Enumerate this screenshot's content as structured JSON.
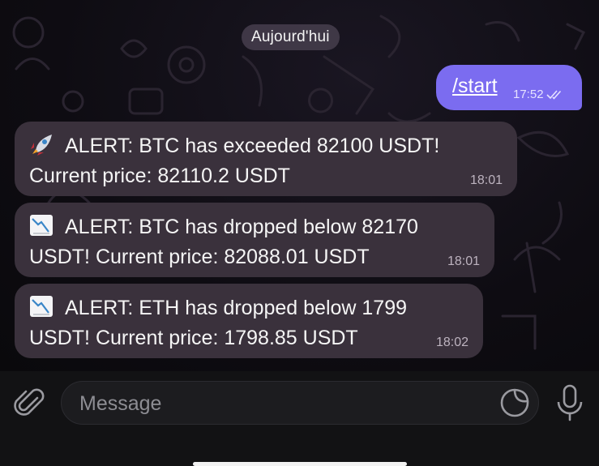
{
  "date_label": "Aujourd'hui",
  "messages": [
    {
      "direction": "out",
      "text": "/start",
      "time": "17:52",
      "status_icon": "double-check-icon"
    },
    {
      "direction": "in",
      "icon": "rocket-emoji",
      "line1": "ALERT: BTC has exceeded 82100 USDT!",
      "line2": "Current price: 82110.2 USDT",
      "time": "18:01"
    },
    {
      "direction": "in",
      "icon": "chart-decreasing-emoji",
      "line1": "ALERT: BTC has dropped below 82170",
      "line2": "USDT! Current price: 82088.01 USDT",
      "time": "18:01"
    },
    {
      "direction": "in",
      "icon": "chart-decreasing-emoji",
      "line1": "ALERT: ETH has dropped below 1799",
      "line2": "USDT! Current price: 1798.85 USDT",
      "time": "18:02"
    }
  ],
  "composer": {
    "placeholder": "Message",
    "attach_icon": "paperclip-icon",
    "sticker_icon": "sticker-icon",
    "mic_icon": "microphone-icon"
  },
  "colors": {
    "outgoing_bubble": "#7b6cf0",
    "incoming_bubble": "#3a313c",
    "background": "#0e0c12"
  }
}
